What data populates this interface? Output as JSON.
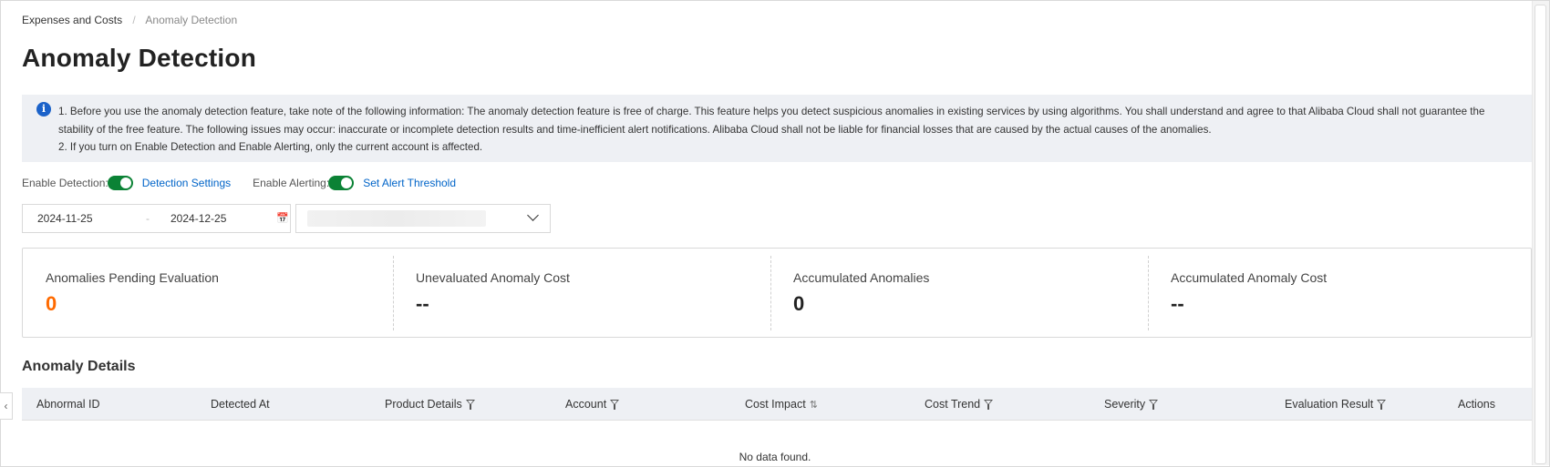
{
  "breadcrumb": {
    "parent": "Expenses and Costs",
    "separator": "/",
    "current": "Anomaly Detection"
  },
  "page_title": "Anomaly Detection",
  "notice": {
    "icon": "info-icon",
    "line1": "1. Before you use the anomaly detection feature, take note of the following information: The anomaly detection feature is free of charge. This feature helps you detect suspicious anomalies in existing services by using algorithms. You shall understand and agree to that Alibaba Cloud shall not guarantee the stability of the free feature. The following issues may occur: inaccurate or incomplete detection results and time-inefficient alert notifications. Alibaba Cloud shall not be liable for financial losses that are caused by the actual causes of the anomalies.",
    "line2": "2. If you turn on Enable Detection and Enable Alerting, only the current account is affected."
  },
  "toggles": {
    "detection_label": "Enable Detection:",
    "detection_on": true,
    "detection_link": "Detection Settings",
    "alerting_label": "Enable Alerting:",
    "alerting_on": true,
    "alerting_link": "Set Alert Threshold",
    "toggle_color": "#0b8235"
  },
  "filters": {
    "start_date": "2024-11-25",
    "separator": "-",
    "end_date": "2024-12-25",
    "calendar_icon": "calendar-icon",
    "select_icon": "chevron-down-icon"
  },
  "stats": [
    {
      "label": "Anomalies Pending Evaluation",
      "value": "0",
      "highlight": "#ff6a00"
    },
    {
      "label": "Unevaluated Anomaly Cost",
      "value": "--"
    },
    {
      "label": "Accumulated Anomalies",
      "value": "0"
    },
    {
      "label": "Accumulated Anomaly Cost",
      "value": "--"
    }
  ],
  "section_title": "Anomaly Details",
  "table": {
    "columns": [
      {
        "label": "Abnormal ID"
      },
      {
        "label": "Detected At"
      },
      {
        "label": "Product Details",
        "icon": "filter-icon"
      },
      {
        "label": "Account",
        "icon": "filter-icon"
      },
      {
        "label": "Cost Impact",
        "icon": "sort-icon"
      },
      {
        "label": "Cost Trend",
        "icon": "filter-icon"
      },
      {
        "label": "Severity",
        "icon": "filter-icon"
      },
      {
        "label": "Evaluation Result",
        "icon": "filter-icon"
      },
      {
        "label": "Actions"
      }
    ],
    "empty_text": "No data found."
  },
  "collapse_icon": "chevron-left-icon"
}
